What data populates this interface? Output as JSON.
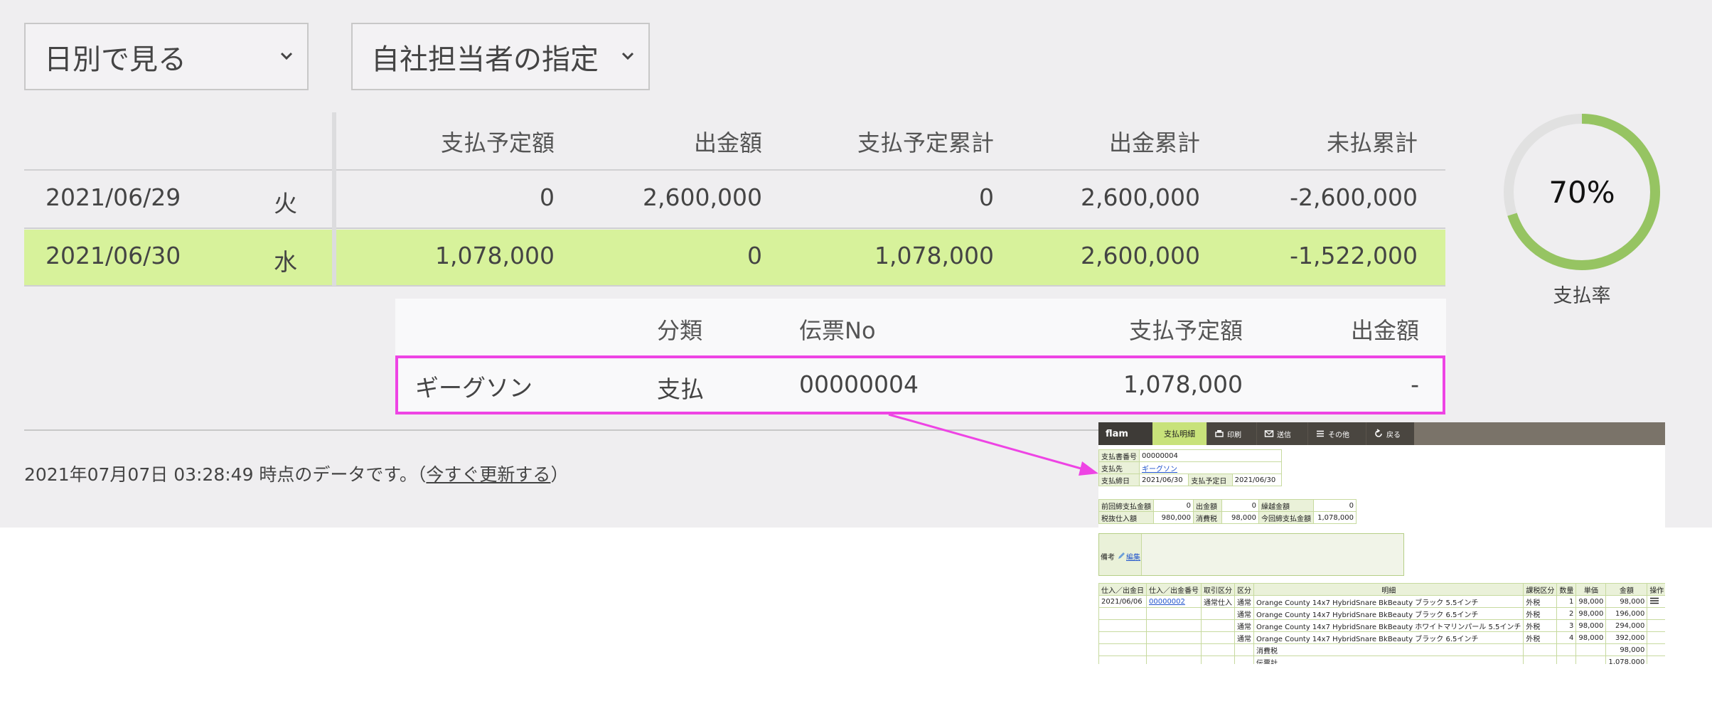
{
  "filters": {
    "view_select": "日別で見る",
    "staff_select": "自社担当者の指定"
  },
  "main_table": {
    "headers": [
      "支払予定額",
      "出金額",
      "支払予定累計",
      "出金累計",
      "未払累計"
    ],
    "rows": [
      {
        "date": "2021/06/29",
        "weekday": "火",
        "values": [
          "0",
          "2,600,000",
          "0",
          "2,600,000",
          "-2,600,000"
        ],
        "highlighted": false
      },
      {
        "date": "2021/06/30",
        "weekday": "水",
        "values": [
          "1,078,000",
          "0",
          "1,078,000",
          "2,600,000",
          "-1,522,000"
        ],
        "highlighted": true
      }
    ]
  },
  "detail_table": {
    "headers": [
      "分類",
      "伝票No",
      "支払予定額",
      "出金額"
    ],
    "row": {
      "name": "ギーグソン",
      "category": "支払",
      "slip_no": "00000004",
      "scheduled": "1,078,000",
      "paid": "-"
    }
  },
  "status": {
    "prefix": "2021年07月07日 03:28:49 時点のデータです。（",
    "link": "今すぐ更新する",
    "suffix": "）"
  },
  "gauge": {
    "percent_text": "70%",
    "value": 0.7,
    "label": "支払率"
  },
  "colors": {
    "highlight": "#d7f29b",
    "gauge": "#96c462",
    "gauge_track": "#e1e1e1",
    "annotation": "#ee44e4"
  },
  "inset": {
    "toolbar": {
      "logo": "flam",
      "active_tab": "支払明細",
      "buttons": [
        {
          "icon": "printer-icon",
          "label": "印刷"
        },
        {
          "icon": "mail-icon",
          "label": "送信"
        },
        {
          "icon": "menu-icon",
          "label": "その他"
        },
        {
          "icon": "back-icon",
          "label": "戻る"
        }
      ]
    },
    "info": {
      "doc_no_label": "支払書番号",
      "doc_no": "00000004",
      "payee_label": "支払先",
      "payee": "ギーグソン",
      "close_label": "支払締日",
      "close_date": "2021/06/30",
      "due_label": "支払予定日",
      "due_date": "2021/06/30"
    },
    "summary": {
      "prev_label": "前回締支払金額",
      "prev": "0",
      "out_label": "出金額",
      "out": "0",
      "carry_label": "繰越金額",
      "carry": "0",
      "taxex_label": "税抜仕入額",
      "taxex": "980,000",
      "tax_label": "消費税",
      "tax": "98,000",
      "cur_label": "今回締支払金額",
      "cur": "1,078,000"
    },
    "memo": {
      "label": "備考",
      "edit": "編集"
    },
    "lines": {
      "headers": [
        "仕入／出金日",
        "仕入／出金番号",
        "取引区分",
        "区分",
        "明細",
        "課税区分",
        "数量",
        "単価",
        "金額",
        "操作"
      ],
      "rows": [
        [
          "2021/06/06",
          "00000002",
          "通常仕入",
          "通常",
          "Orange County 14x7 HybridSnare BkBeauty ブラック 5.5インチ",
          "外税",
          "1",
          "98,000",
          "98,000"
        ],
        [
          "",
          "",
          "",
          "通常",
          "Orange County 14x7 HybridSnare BkBeauty ブラック 6.5インチ",
          "外税",
          "2",
          "98,000",
          "196,000"
        ],
        [
          "",
          "",
          "",
          "通常",
          "Orange County 14x7 HybridSnare BkBeauty ホワイトマリンパール 5.5インチ",
          "外税",
          "3",
          "98,000",
          "294,000"
        ],
        [
          "",
          "",
          "",
          "通常",
          "Orange County 14x7 HybridSnare BkBeauty ブラック 6.5インチ",
          "外税",
          "4",
          "98,000",
          "392,000"
        ],
        [
          "",
          "",
          "",
          "",
          "消費税",
          "",
          "",
          "",
          "98,000"
        ],
        [
          "",
          "",
          "",
          "",
          "伝票計",
          "",
          "",
          "",
          "1,078,000"
        ]
      ]
    }
  }
}
